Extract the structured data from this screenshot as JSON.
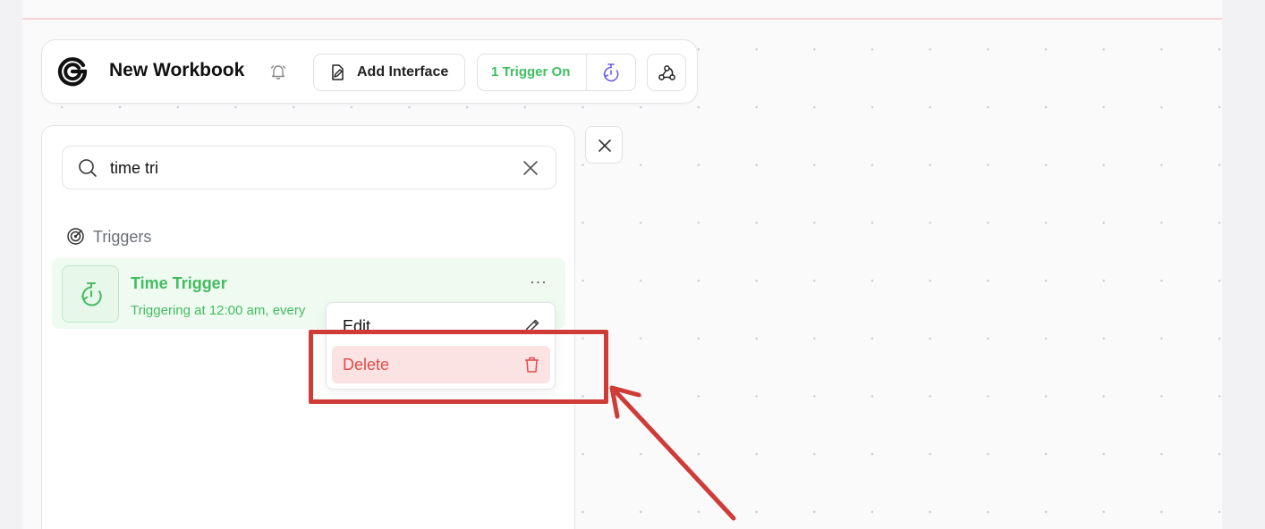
{
  "workbook": {
    "title": "New Workbook"
  },
  "toolbar": {
    "add_interface_label": "Add Interface",
    "trigger_status_label": "1 Trigger On"
  },
  "search": {
    "value": "time tri"
  },
  "section": {
    "label": "Triggers"
  },
  "trigger_item": {
    "name": "Time Trigger",
    "description": "Triggering at 12:00 am, every",
    "more_label": "···"
  },
  "context_menu": {
    "edit_label": "Edit",
    "delete_label": "Delete"
  },
  "colors": {
    "accent_green": "#43bb60",
    "danger_red": "#e24b4b",
    "annotation_red": "#cf3b37",
    "purple_icon": "#6b5ce7"
  },
  "icons": {
    "logo": "app-logo-icon",
    "bell": "bell-icon",
    "add_interface": "document-pen-icon",
    "trigger_status": "timer-icon",
    "webhook": "webhook-icon",
    "search": "search-icon",
    "clear": "close-icon",
    "section": "target-icon",
    "trigger": "timer-icon",
    "edit": "pencil-icon",
    "delete": "trash-icon",
    "close_panel": "close-icon"
  }
}
